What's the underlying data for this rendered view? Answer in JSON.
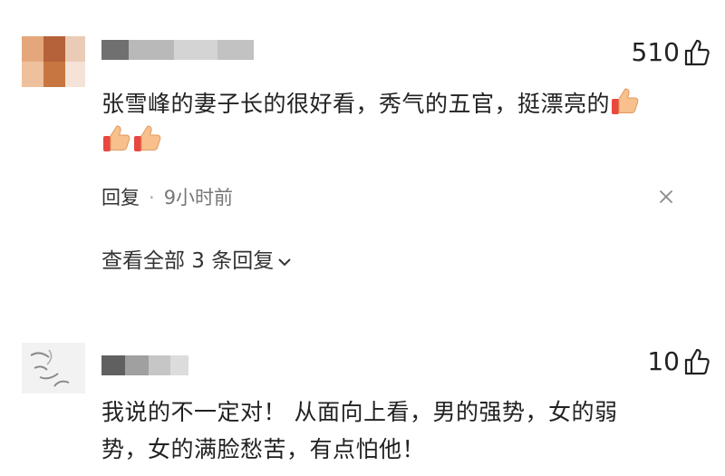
{
  "comments": [
    {
      "likes": "510",
      "text_line1": "张雪峰的妻子长的很好看，秀气的五官，挺漂亮的",
      "text_line2": "",
      "reply_label": "回复",
      "separator": "·",
      "time": "9小时前",
      "more_replies": "查看全部 3 条回复"
    },
    {
      "likes": "10",
      "text_line1": "我说的不一定对！ 从面向上看，男的强势，女的弱",
      "text_line2": "势，女的满脸愁苦，有点怕他！"
    }
  ],
  "icons": {
    "like": "thumbs-up-icon",
    "emoji": "thumbs-up-emoji",
    "close": "close-icon",
    "expand": "chevron-down-icon"
  }
}
